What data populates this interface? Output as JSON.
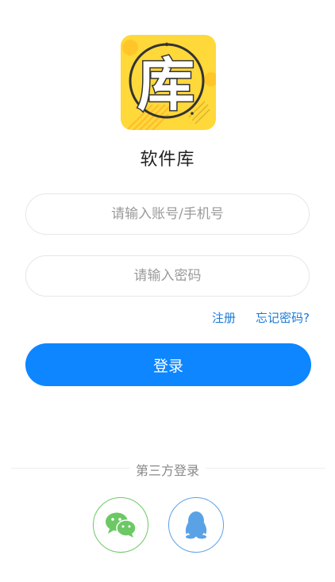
{
  "app": {
    "name": "软件库",
    "logo_glyph": "库",
    "logo_colors": {
      "background": "#ffd83a",
      "glyph_fill": "#ffffff",
      "glyph_stroke": "#333333"
    }
  },
  "form": {
    "account_placeholder": "请输入账号/手机号",
    "password_placeholder": "请输入密码",
    "register_label": "注册",
    "forgot_label": "忘记密码?",
    "login_label": "登录"
  },
  "third_party": {
    "label": "第三方登录",
    "providers": [
      {
        "name": "wechat-icon",
        "color": "#6cc864"
      },
      {
        "name": "qq-icon",
        "color": "#5aa2e6"
      }
    ]
  },
  "colors": {
    "accent": "#0d86ff",
    "link": "#1a7ad9"
  }
}
